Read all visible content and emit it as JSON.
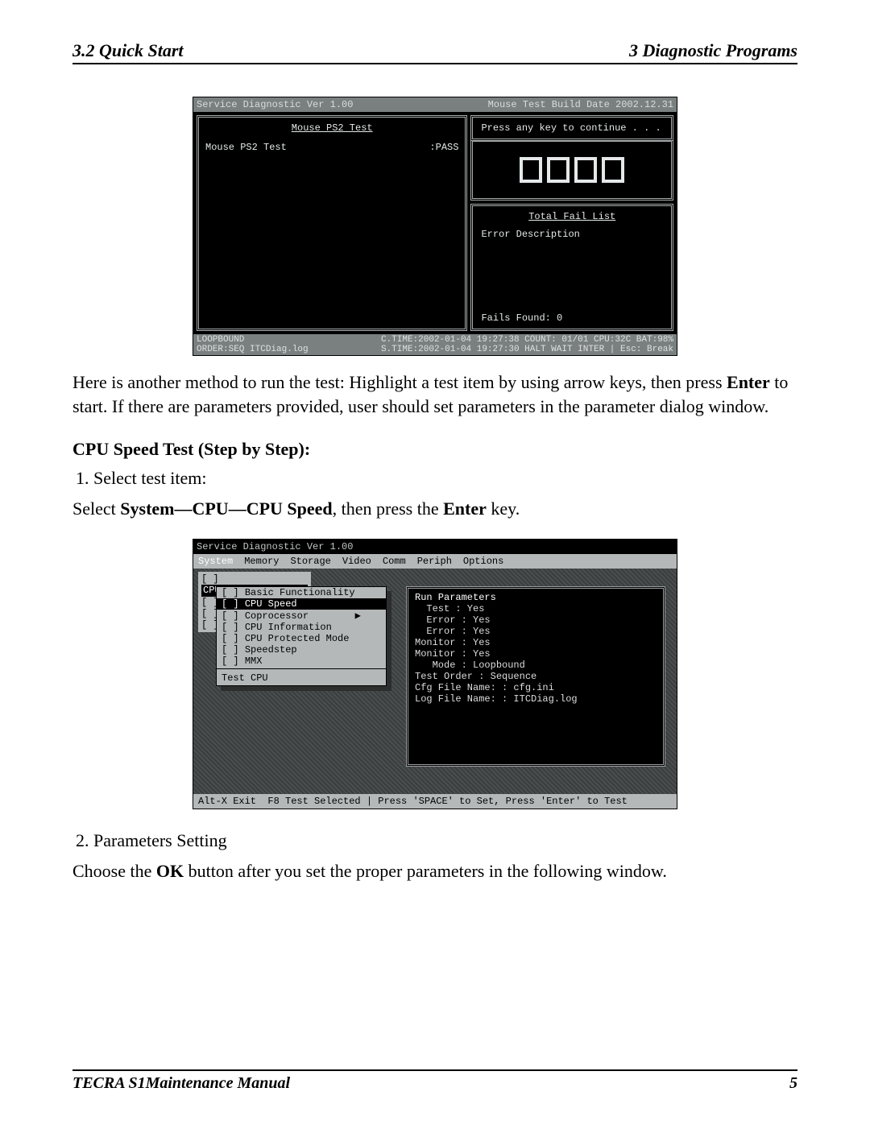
{
  "header": {
    "left": "3.2 Quick Start",
    "right": "3  Diagnostic Programs"
  },
  "shot1": {
    "titlebar_left": "Service Diagnostic Ver 1.00",
    "titlebar_right": "Mouse Test Build Date 2002.12.31",
    "panel_title": "Mouse PS2 Test",
    "test_name": "Mouse PS2 Test",
    "test_result": ":PASS",
    "dialog_msg": "Press any key to continue . . .",
    "fail_title": "Total Fail List",
    "fail_header": "Error  Description",
    "fail_count": "Fails Found: 0",
    "status1_left": "LOOPBOUND",
    "status1_right": "C.TIME:2002-01-04 19:27:38 COUNT: 01/01  CPU:32C BAT:98%",
    "status2_left": "ORDER:SEQ  ITCDiag.log",
    "status2_right": "S.TIME:2002-01-04 19:27:30 HALT WAIT INTER  | Esc: Break"
  },
  "para1_a": "Here is another method to run the test: Highlight a test item by using arrow keys, then press ",
  "para1_b": "Enter",
  "para1_c": " to start. If there are parameters provided, user should set parameters in the parameter dialog window.",
  "cpu_title": "CPU Speed Test (Step by Step):",
  "step1": "Select test item:",
  "select_line_a": "Select ",
  "select_line_b": "System—CPU—CPU Speed",
  "select_line_c": ", then press the ",
  "select_line_d": "Enter",
  "select_line_e": " key.",
  "shot2": {
    "title": "Service Diagnostic Ver 1.00",
    "menubar": [
      "System",
      "Memory",
      "Storage",
      "Video",
      "Comm",
      "Periph",
      "Options"
    ],
    "syspanel_hl": "CPU",
    "syspanel_arrow": "▶",
    "cpusub": {
      "items": [
        {
          "chk": "[ ]",
          "label": "Basic Functionality",
          "arrow": ""
        },
        {
          "chk": "[ ]",
          "label": "CPU Speed",
          "arrow": "",
          "hl": true
        },
        {
          "chk": "[ ]",
          "label": "Coprocessor",
          "arrow": "▶"
        },
        {
          "chk": "[ ]",
          "label": "CPU Information",
          "arrow": ""
        },
        {
          "chk": "[ ]",
          "label": "CPU Protected Mode",
          "arrow": ""
        },
        {
          "chk": "[ ]",
          "label": "Speedstep",
          "arrow": ""
        },
        {
          "chk": "[ ]",
          "label": "MMX",
          "arrow": ""
        }
      ],
      "hint": "Test CPU"
    },
    "runpanel": {
      "title": "Run Parameters",
      "lines": [
        "  Test : Yes",
        "  Error : Yes",
        "  Error : Yes",
        "",
        "Monitor : Yes",
        "Monitor : Yes",
        "",
        "   Mode : Loopbound",
        "Test Order : Sequence",
        "",
        "Cfg File Name: : cfg.ini",
        "Log File Name: : ITCDiag.log"
      ]
    },
    "helpbar": "Alt-X Exit  F8 Test Selected | Press 'SPACE' to Set, Press 'Enter' to Test"
  },
  "step2": "Parameters Setting",
  "para2_a": "Choose the ",
  "para2_b": "OK",
  "para2_c": " button after you set the proper parameters in the following window.",
  "footer": {
    "left": "TECRA S1Maintenance Manual",
    "right": "5"
  }
}
